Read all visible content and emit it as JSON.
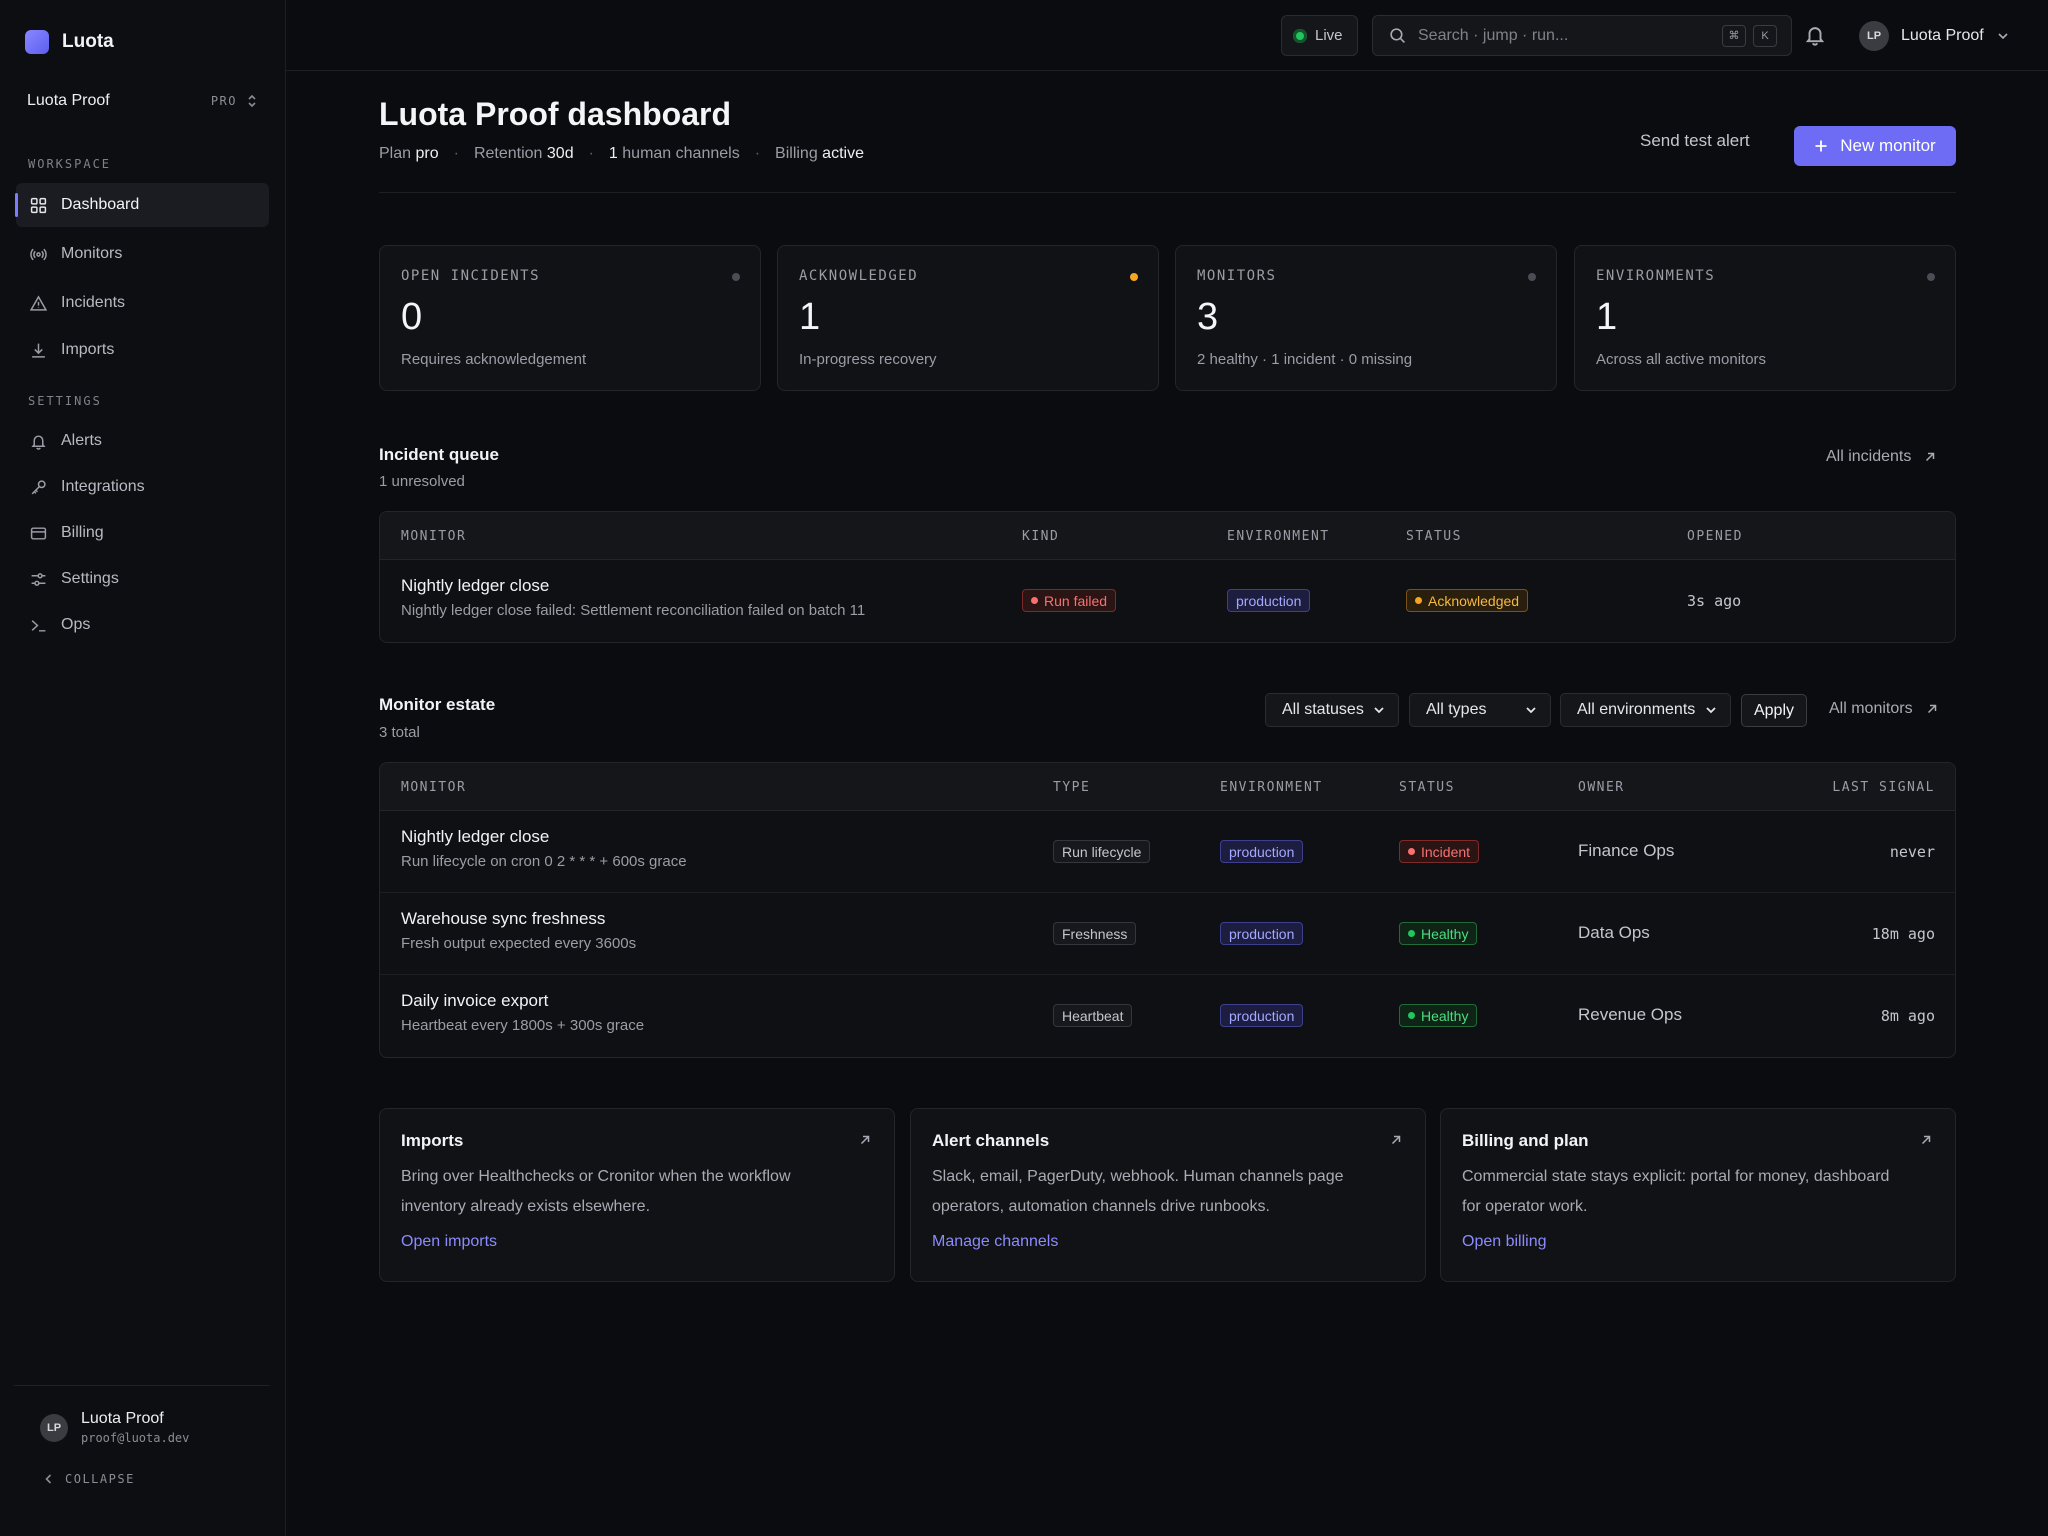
{
  "app": {
    "name": "Luota"
  },
  "workspace": {
    "name": "Luota Proof",
    "plan_badge": "PRO"
  },
  "sidebar": {
    "section_workspace": "WORKSPACE",
    "section_settings": "SETTINGS",
    "items": [
      {
        "label": "Dashboard",
        "icon": "grid-icon"
      },
      {
        "label": "Monitors",
        "icon": "broadcast-icon"
      },
      {
        "label": "Incidents",
        "icon": "warning-icon"
      },
      {
        "label": "Imports",
        "icon": "download-icon"
      },
      {
        "label": "Alerts",
        "icon": "bell-icon"
      },
      {
        "label": "Integrations",
        "icon": "key-icon"
      },
      {
        "label": "Billing",
        "icon": "card-icon"
      },
      {
        "label": "Settings",
        "icon": "sliders-icon"
      },
      {
        "label": "Ops",
        "icon": "terminal-icon"
      }
    ],
    "user": {
      "initials": "LP",
      "name": "Luota Proof",
      "email": "proof@luota.dev"
    },
    "collapse_label": "COLLAPSE"
  },
  "topbar": {
    "live_label": "Live",
    "search_placeholder": "Search · jump · run...",
    "kbd_1": "⌘",
    "kbd_2": "K",
    "user_initials": "LP",
    "user_name": "Luota Proof"
  },
  "header": {
    "title": "Luota Proof dashboard",
    "plan_label": "Plan",
    "plan_value": "pro",
    "retention_label": "Retention",
    "retention_value": "30d",
    "channels_value": "1",
    "channels_label": "human channels",
    "billing_label": "Billing",
    "billing_value": "active",
    "sep": "·",
    "send_test": "Send test alert",
    "new_monitor": "New monitor"
  },
  "stats": [
    {
      "label": "OPEN INCIDENTS",
      "value": "0",
      "sub": "Requires acknowledgement"
    },
    {
      "label": "ACKNOWLEDGED",
      "value": "1",
      "sub": "In-progress recovery"
    },
    {
      "label": "MONITORS",
      "value": "3",
      "sub": "2 healthy · 1 incident · 0 missing"
    },
    {
      "label": "ENVIRONMENTS",
      "value": "1",
      "sub": "Across all active monitors"
    }
  ],
  "colors": {
    "accent": "#6e6cf5",
    "acknowledged_dot": "#f5a524"
  },
  "incident_queue": {
    "title": "Incident queue",
    "subtitle": "1 unresolved",
    "link": "All incidents",
    "columns": [
      "MONITOR",
      "KIND",
      "ENVIRONMENT",
      "STATUS",
      "OPENED"
    ],
    "rows": [
      {
        "monitor": "Nightly ledger close",
        "detail": "Nightly ledger close failed: Settlement reconciliation failed on batch 11",
        "kind": "Run failed",
        "environment": "production",
        "status": "Acknowledged",
        "opened": "3s ago"
      }
    ]
  },
  "monitor_estate": {
    "title": "Monitor estate",
    "subtitle": "3 total",
    "filters": {
      "status": "All statuses",
      "type": "All types",
      "environment": "All environments"
    },
    "apply": "Apply",
    "link": "All monitors",
    "columns": [
      "MONITOR",
      "TYPE",
      "ENVIRONMENT",
      "STATUS",
      "OWNER",
      "LAST SIGNAL"
    ],
    "rows": [
      {
        "name": "Nightly ledger close",
        "detail": "Run lifecycle on cron 0 2 * * * + 600s grace",
        "type": "Run lifecycle",
        "environment": "production",
        "status": "Incident",
        "owner": "Finance Ops",
        "last_signal": "never"
      },
      {
        "name": "Warehouse sync freshness",
        "detail": "Fresh output expected every 3600s",
        "type": "Freshness",
        "environment": "production",
        "status": "Healthy",
        "owner": "Data Ops",
        "last_signal": "18m ago"
      },
      {
        "name": "Daily invoice export",
        "detail": "Heartbeat every 1800s + 300s grace",
        "type": "Heartbeat",
        "environment": "production",
        "status": "Healthy",
        "owner": "Revenue Ops",
        "last_signal": "8m ago"
      }
    ]
  },
  "cards": [
    {
      "title": "Imports",
      "body": "Bring over Healthchecks or Cronitor when the workflow inventory already exists elsewhere.",
      "link": "Open imports"
    },
    {
      "title": "Alert channels",
      "body": "Slack, email, PagerDuty, webhook. Human channels page operators, automation channels drive runbooks.",
      "link": "Manage channels"
    },
    {
      "title": "Billing and plan",
      "body": "Commercial state stays explicit: portal for money, dashboard for operator work.",
      "link": "Open billing"
    }
  ]
}
